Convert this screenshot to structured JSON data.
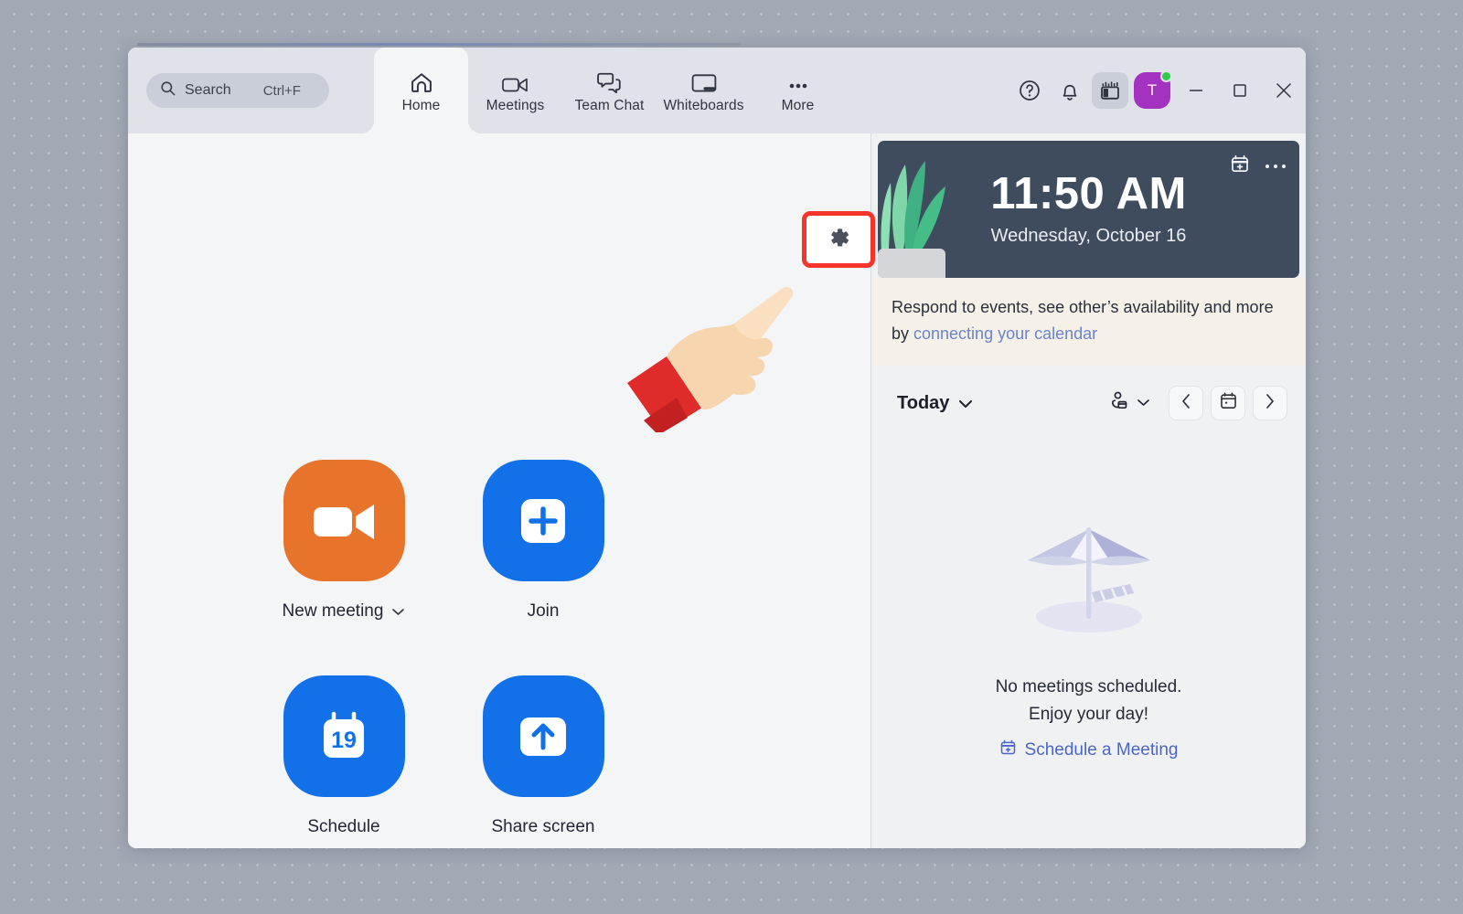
{
  "window": {
    "search": {
      "label": "Search",
      "shortcut": "Ctrl+F",
      "icon": "search-icon"
    },
    "tabs": [
      {
        "label": "Home",
        "icon": "home-icon",
        "active": true
      },
      {
        "label": "Meetings",
        "icon": "video-camera-icon",
        "active": false
      },
      {
        "label": "Team Chat",
        "icon": "chat-bubbles-icon",
        "active": false
      },
      {
        "label": "Whiteboards",
        "icon": "whiteboard-icon",
        "active": false
      },
      {
        "label": "More",
        "icon": "ellipsis-icon",
        "active": false
      }
    ],
    "controls": {
      "help": "help-circle-icon",
      "notifications": "bell-icon",
      "panel": "layout-panel-icon",
      "avatar_initial": "T",
      "presence": "available",
      "minimize": "minimize-icon",
      "maximize": "maximize-icon",
      "close": "close-icon"
    }
  },
  "main": {
    "settings_button": {
      "icon": "gear-icon",
      "highlighted": true
    },
    "pointer": "pointing-hand-cursor",
    "actions": [
      {
        "label": "New meeting",
        "icon": "video-camera-icon",
        "color": "#e8732a",
        "has_caret": true
      },
      {
        "label": "Join",
        "icon": "plus-in-square-icon",
        "color": "#1271e8",
        "has_caret": false
      },
      {
        "label": "Schedule",
        "icon": "calendar-19-icon",
        "color": "#1271e8",
        "has_caret": false,
        "calendar_day": "19"
      },
      {
        "label": "Share screen",
        "icon": "up-arrow-in-square-icon",
        "color": "#1271e8",
        "has_caret": false
      }
    ]
  },
  "calendar_panel": {
    "clock": {
      "time": "11:50 AM",
      "date": "Wednesday, October 16",
      "add_event_icon": "calendar-plus-icon",
      "more_icon": "ellipsis-icon",
      "background": "#3f4c5e",
      "art": "potted-plant-illustration"
    },
    "notice": {
      "text_before": "Respond to events, see other’s availability and more by ",
      "link": "connecting your calendar",
      "background": "#f5f1e9"
    },
    "daybar": {
      "range_label": "Today",
      "range_caret": "chevron-down-icon",
      "people_icon": "person-calendar-icon",
      "people_caret": "chevron-down-icon",
      "prev": "chevron-left-icon",
      "today": "calendar-icon",
      "next": "chevron-right-icon"
    },
    "empty_state": {
      "illustration": "beach-umbrella-illustration",
      "line1": "No meetings scheduled.",
      "line2": "Enjoy your day!",
      "link": "Schedule a Meeting",
      "link_icon": "calendar-plus-icon"
    }
  },
  "theme": {
    "desktop_bg": "#a2a8b4",
    "titlebar_bg": "#dfe2e8",
    "content_bg": "#f4f5f7",
    "panel_bg": "#f0f1f3",
    "accent_blue": "#1271e8",
    "accent_orange": "#e8732a",
    "avatar_purple": "#a332c0",
    "highlight_red": "#f5342c",
    "link_blue": "#4a66c6"
  }
}
